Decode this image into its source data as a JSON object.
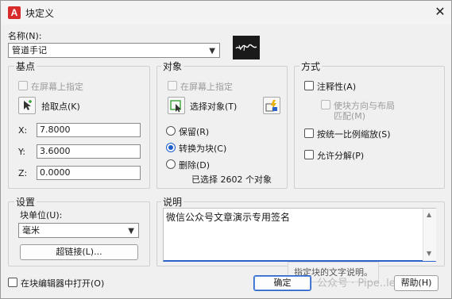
{
  "window": {
    "title": "块定义",
    "app_icon_letter": "A"
  },
  "name": {
    "label": "名称(N):",
    "value": "管道手记"
  },
  "preview": {
    "text": "管道手记"
  },
  "base_point": {
    "title": "基点",
    "on_screen": "在屏幕上指定",
    "pick_point": "拾取点(K)",
    "x_label": "X:",
    "x_value": "7.8000",
    "y_label": "Y:",
    "y_value": "3.6000",
    "z_label": "Z:",
    "z_value": "0.0000"
  },
  "objects": {
    "title": "对象",
    "on_screen": "在屏幕上指定",
    "select_objects": "选择对象(T)",
    "retain": "保留(R)",
    "convert": "转换为块(C)",
    "delete": "删除(D)",
    "selected_count": "已选择 2602 个对象"
  },
  "behavior": {
    "title": "方式",
    "annotative": "注释性(A)",
    "match_orientation_line1": "使块方向与布局",
    "match_orientation_line2": "匹配(M)",
    "scale_uniformly": "按统一比例缩放(S)",
    "allow_explode": "允许分解(P)"
  },
  "settings": {
    "title": "设置",
    "unit_label": "块单位(U):",
    "unit_value": "毫米",
    "hyperlink": "超链接(L)..."
  },
  "description": {
    "title": "说明",
    "value": "微信公众号文章演示专用签名",
    "tooltip": "指定块的文字说明。"
  },
  "footer": {
    "open_in_editor": "在块编辑器中打开(O)",
    "ok": "确定",
    "help": "帮助(H)"
  },
  "watermark": {
    "text": "公众号 · Pipe..le"
  }
}
